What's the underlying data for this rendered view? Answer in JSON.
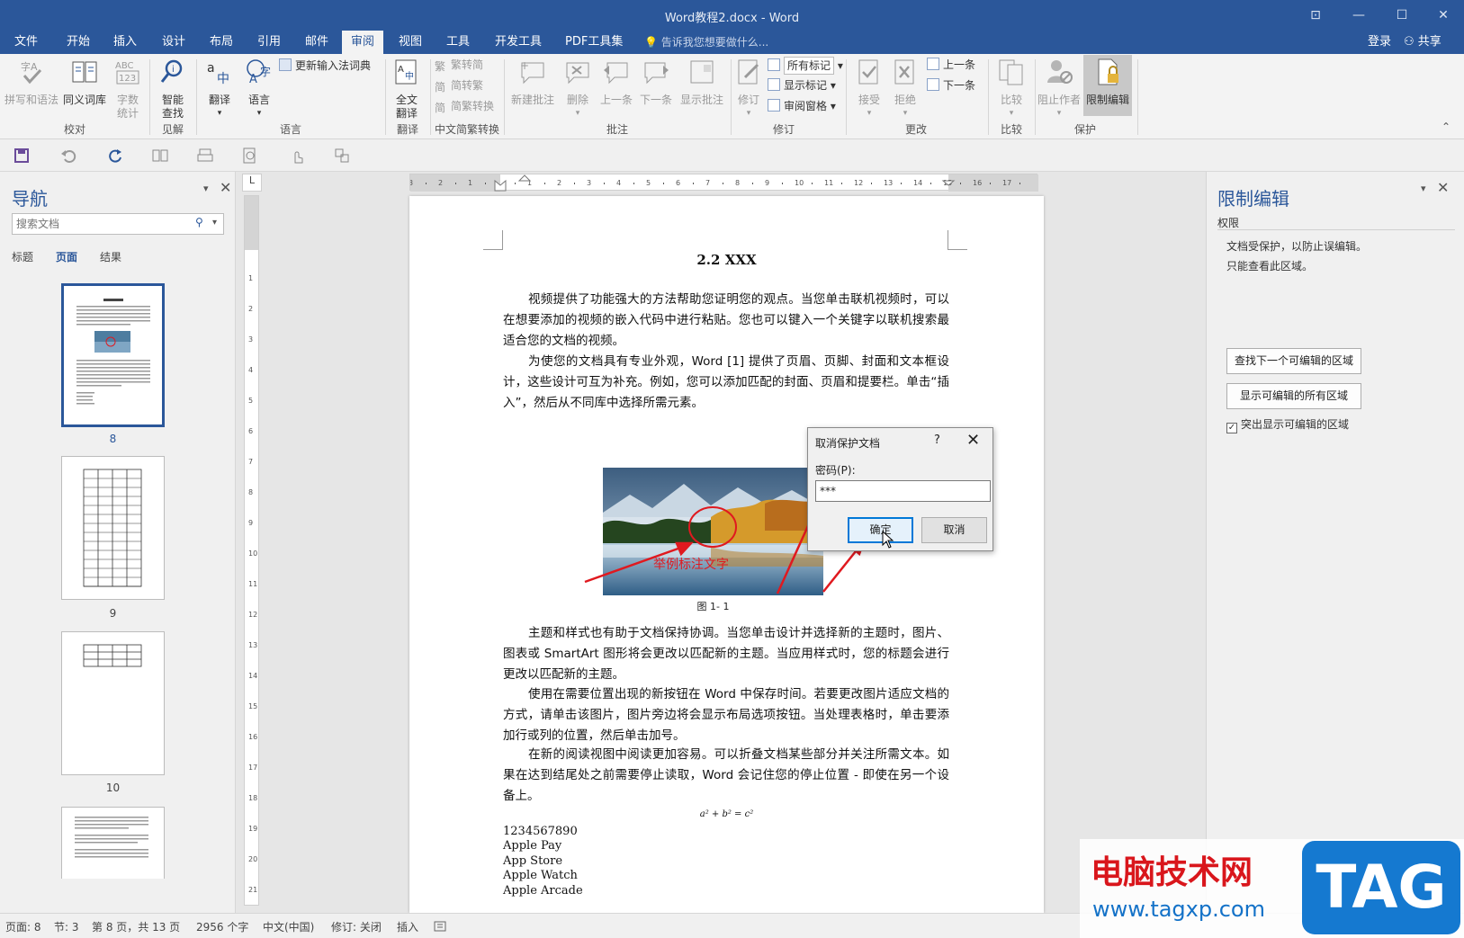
{
  "window": {
    "title": "Word教程2.docx - Word",
    "controls": [
      "⊡",
      "—",
      "☐",
      "✕"
    ]
  },
  "ribbon_tabs": [
    "文件",
    "开始",
    "插入",
    "设计",
    "布局",
    "引用",
    "邮件",
    "审阅",
    "视图",
    "工具",
    "开发工具",
    "PDF工具集"
  ],
  "active_tab": "审阅",
  "tell_me": "告诉我您想要做什么...",
  "login": "登录",
  "share": "共享",
  "ribbon": {
    "proofing": {
      "spelling": "拼写和语法",
      "thesaurus": "同义词库",
      "wordcount_1": "字数",
      "wordcount_2": "统计",
      "group": "校对"
    },
    "insights": {
      "smart_1": "智能",
      "smart_2": "查找",
      "group": "见解"
    },
    "language": {
      "translate": "翻译",
      "language": "语言",
      "update_ime": "更新输入法词典",
      "group": "语言"
    },
    "translation": {
      "full_1": "全文",
      "full_2": "翻译",
      "group": "翻译"
    },
    "chinese": {
      "t2s": "繁转简",
      "s2t": "简转繁",
      "convert": "简繁转换",
      "group": "中文简繁转换"
    },
    "comments": {
      "new": "新建批注",
      "delete": "删除",
      "prev": "上一条",
      "next": "下一条",
      "show": "显示批注",
      "group": "批注"
    },
    "tracking": {
      "track": "修订",
      "all_markup": "所有标记",
      "show_markup": "显示标记",
      "pane": "审阅窗格",
      "group": "修订"
    },
    "changes": {
      "accept": "接受",
      "reject": "拒绝",
      "prev": "上一条",
      "next": "下一条",
      "group": "更改"
    },
    "compare": {
      "compare": "比较",
      "group": "比较"
    },
    "protect": {
      "block": "阻止作者",
      "restrict": "限制编辑",
      "group": "保护"
    }
  },
  "nav": {
    "title": "导航",
    "search_placeholder": "搜索文档",
    "tabs": [
      "标题",
      "页面",
      "结果"
    ],
    "active_tab": "页面",
    "pages": [
      "8",
      "9",
      "10"
    ],
    "selected_page": "8"
  },
  "ruler_corner": "L",
  "document": {
    "heading": "2.2 XXX",
    "p1": "视频提供了功能强大的方法帮助您证明您的观点。当您单击联机视频时，可以在想要添加的视频的嵌入代码中进行粘贴。您也可以键入一个关键字以联机搜索最适合您的文档的视频。",
    "p2": "为使您的文档具有专业外观，Word [1] 提供了页眉、页脚、封面和文本框设计，这些设计可互为补充。例如，您可以添加匹配的封面、页眉和提要栏。单击“插入”，然后从不同库中选择所需元素。",
    "figure_annotation": "举例标注文字",
    "figure_caption": "图 1- 1",
    "p3": "主题和样式也有助于文档保持协调。当您单击设计并选择新的主题时，图片、图表或 SmartArt 图形将会更改以匹配新的主题。当应用样式时，您的标题会进行更改以匹配新的主题。",
    "p4": "使用在需要位置出现的新按钮在 Word 中保存时间。若要更改图片适应文档的方式，请单击该图片，图片旁边将会显示布局选项按钮。当处理表格时，单击要添加行或列的位置，然后单击加号。",
    "p5": "在新的阅读视图中阅读更加容易。可以折叠文档某些部分并关注所需文本。如果在达到结尾处之前需要停止读取，Word 会记住您的停止位置 - 即使在另一个设备上。",
    "formula": "a² + b² = c²",
    "lines": [
      "1234567890",
      "Apple Pay",
      "App Store",
      "Apple Watch",
      "Apple Arcade"
    ]
  },
  "dialog": {
    "title": "取消保护文档",
    "help": "?",
    "close": "✕",
    "password_label": "密码(P):",
    "password_value": "***",
    "ok": "确定",
    "cancel": "取消"
  },
  "restrict_pane": {
    "title": "限制编辑",
    "section": "权限",
    "line1": "文档受保护，以防止误编辑。",
    "line2": "只能查看此区域。",
    "find_next": "查找下一个可编辑的区域",
    "show_all": "显示可编辑的所有区域",
    "highlight": "突出显示可编辑的区域",
    "highlight_checked": true
  },
  "status": {
    "page": "页面: 8",
    "section": "节: 3",
    "page_of": "第 8 页，共 13 页",
    "words": "2956 个字",
    "language": "中文(中国)",
    "track": "修订: 关闭",
    "mode": "插入"
  },
  "watermark": {
    "cn": "电脑技术网",
    "url": "www.tagxp.com",
    "tag": "TAG"
  },
  "colors": {
    "brand": "#2b579a",
    "annotation_red": "#e0191f",
    "watermark_red": "#d9161c",
    "watermark_blue": "#1579d0"
  }
}
